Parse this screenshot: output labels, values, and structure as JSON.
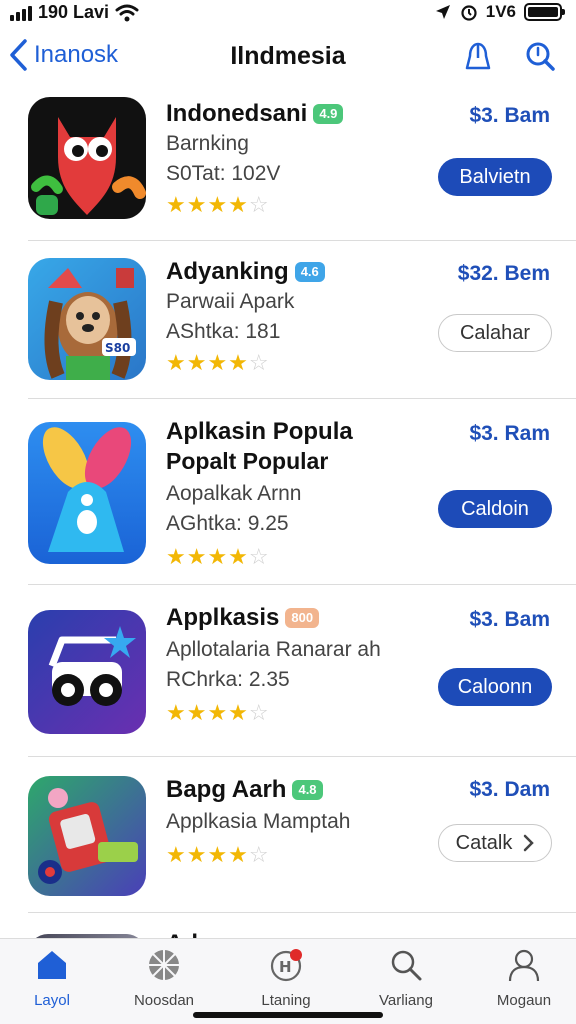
{
  "status_bar": {
    "time": "190 Lavi",
    "right_text": "1V6",
    "icons": [
      "signal-icon",
      "wifi-icon",
      "navigation-icon",
      "alarm-icon",
      "battery-icon"
    ]
  },
  "nav": {
    "back_label": "Inanosk",
    "title": "Ilndmesia",
    "icons": [
      "share-icon",
      "search-icon"
    ]
  },
  "apps": [
    {
      "name": "Indonedsani",
      "badge": "4.9",
      "badge_color": "#4cc77a",
      "sub1": "Barnking",
      "sub2": "S0Tat: 102V",
      "rating": 4,
      "price": "$3. Bam",
      "button": "Balvietn",
      "button_style": "primary"
    },
    {
      "name": "Adyanking",
      "badge": "4.6",
      "badge_color": "#3fa5e8",
      "sub1": "Parwaii Apark",
      "sub2": "AShtka: 181",
      "rating": 4,
      "price": "$32. Bem",
      "button": "Calahar",
      "button_style": "secondary"
    },
    {
      "name": "Aplkasin Popula",
      "name2": "Popalt Popular",
      "sub1": "Aopalkak Arnn",
      "sub2": "AGhtka: 9.25",
      "rating": 4,
      "price": "$3. Ram",
      "button": "Caldoin",
      "button_style": "primary"
    },
    {
      "name": "Applkasis",
      "badge": "800",
      "badge_color": "#f2b48e",
      "sub1": "Apllotalaria Ranarar ah",
      "sub2": "RChrka: 2.35",
      "rating": 4,
      "price": "$3. Bam",
      "button": "Caloonn",
      "button_style": "primary"
    },
    {
      "name": "Bapg Aarh",
      "badge": "4.8",
      "badge_color": "#4cc77a",
      "sub1": "Applkasia Mamptah",
      "rating": 4,
      "price": "$3. Dam",
      "button": "Catalk",
      "button_style": "secondary"
    }
  ],
  "partial_row": {
    "name": "Adya"
  },
  "tabs": [
    {
      "label": "Layol",
      "icon": "home-icon",
      "active": true
    },
    {
      "label": "Noosdan",
      "icon": "grid-icon",
      "active": false
    },
    {
      "label": "Ltaning",
      "icon": "updates-icon",
      "active": false
    },
    {
      "label": "Varliang",
      "icon": "search-icon",
      "active": false
    },
    {
      "label": "Mogaun",
      "icon": "profile-icon",
      "active": false
    }
  ],
  "colors": {
    "accent": "#1f5fd6",
    "button_primary": "#1d4bb8",
    "price": "#1f4fb8",
    "star": "#f2b705"
  }
}
